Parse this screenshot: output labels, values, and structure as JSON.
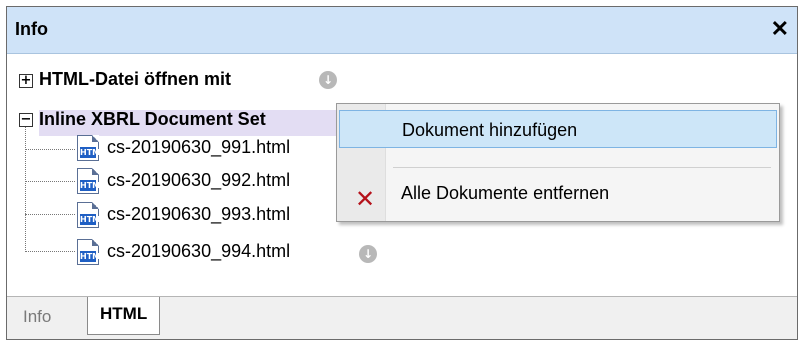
{
  "window": {
    "title": "Info",
    "close_glyph": "✕"
  },
  "tree": {
    "nodes": [
      {
        "label": "HTML-Datei öffnen mit",
        "expander": "+"
      },
      {
        "label": "Inline XBRL Document Set",
        "expander": "−"
      }
    ],
    "files": [
      {
        "label": "cs-20190630_991.html",
        "icon_text": "HTM"
      },
      {
        "label": "cs-20190630_992.html",
        "icon_text": "HTM"
      },
      {
        "label": "cs-20190630_993.html",
        "icon_text": "HTM"
      },
      {
        "label": "cs-20190630_994.html",
        "icon_text": "HTM"
      }
    ],
    "action_glyph": "↓"
  },
  "context_menu": {
    "items": [
      {
        "label": "Dokument hinzufügen",
        "icon": "",
        "selected": true
      },
      {
        "label": "Alle Dokumente entfernen",
        "icon": "delete-x-icon",
        "selected": false
      }
    ],
    "x_glyph": "✕"
  },
  "tabs": [
    {
      "label": "Info",
      "active": false
    },
    {
      "label": "HTML",
      "active": true
    }
  ],
  "colors": {
    "titlebar": "#cfe3f8",
    "highlight": "#e3ddf3",
    "menu_selected": "#cde6f8",
    "file_icon_band": "#1f5fc4",
    "delete_icon": "#b5121b"
  }
}
